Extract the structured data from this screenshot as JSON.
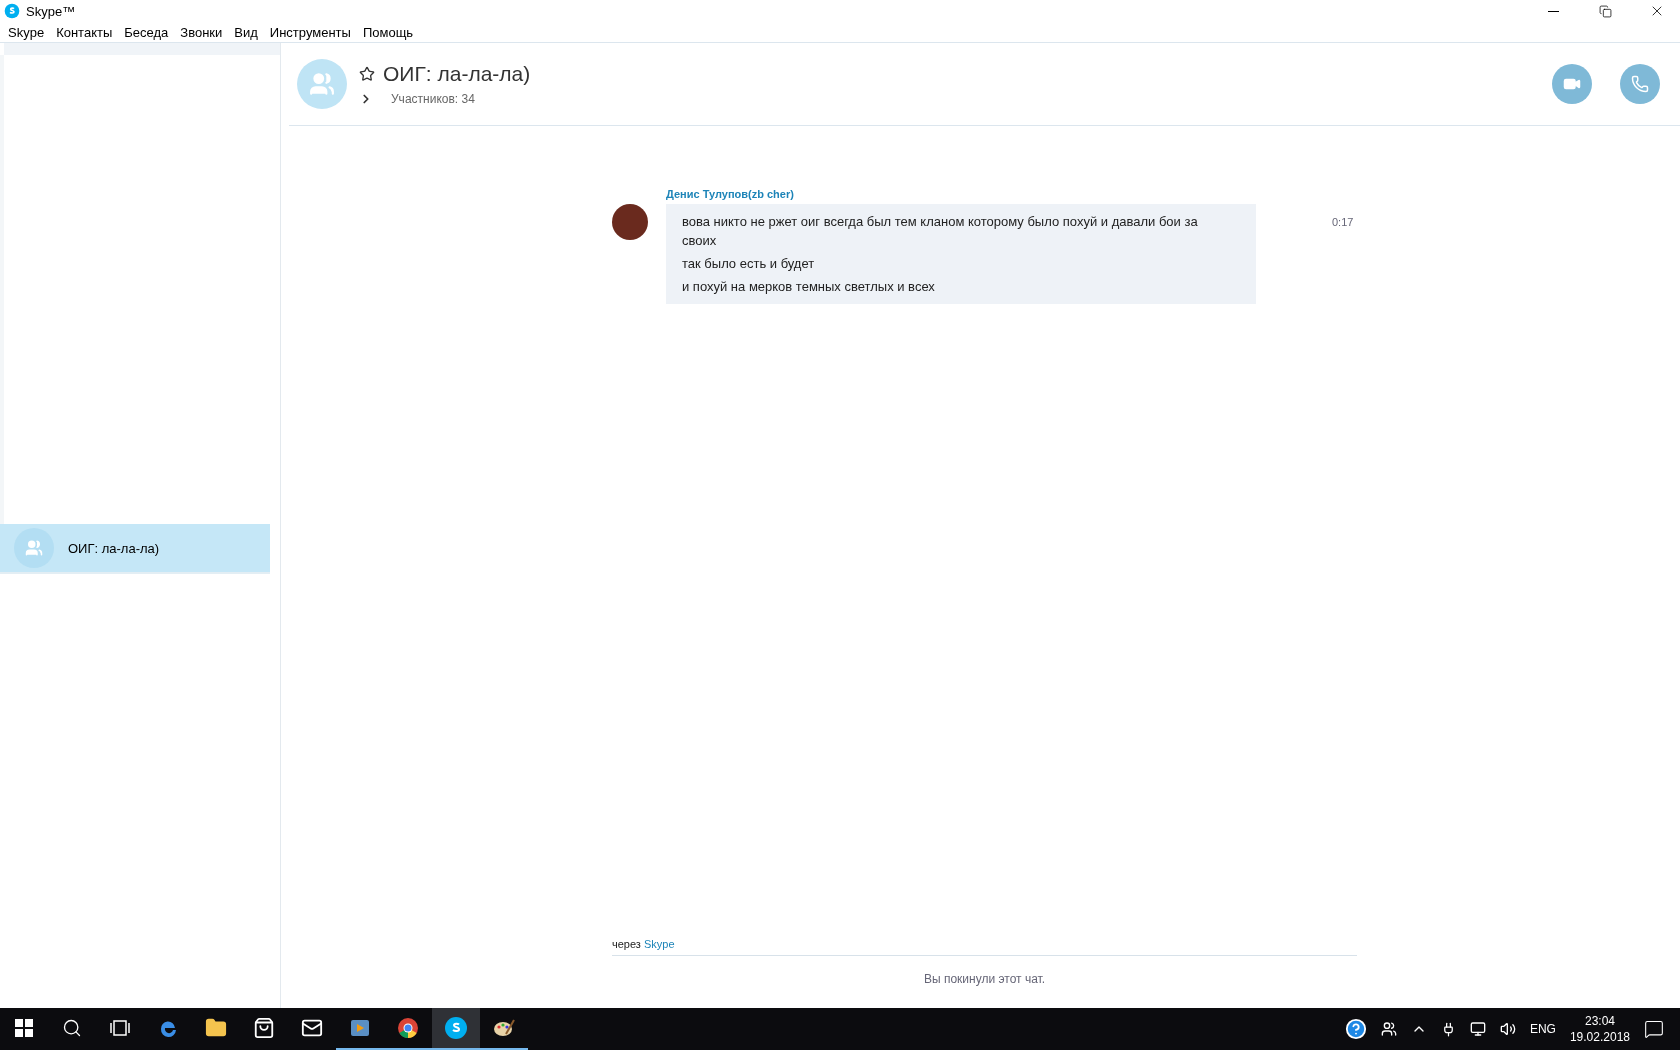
{
  "window": {
    "title": "Skype™"
  },
  "menu": [
    "Skype",
    "Контакты",
    "Беседа",
    "Звонки",
    "Вид",
    "Инструменты",
    "Помощь"
  ],
  "sidebar": {
    "items": [
      {
        "title": "ОИГ: ла-ла-ла)",
        "selected": true
      }
    ]
  },
  "conversation": {
    "title": "ОИГ: ла-ла-ла)",
    "favorite": false,
    "participants": "Участников: 34"
  },
  "messages": [
    {
      "author": "Денис Тулупов(zb cher)",
      "time": "0:17",
      "lines": [
        "вова никто не ржет оиг всегда был тем кланом которому было похуй и давали бои за своих",
        "так было есть и будет",
        "и похуй на мерков темных светлых и всех"
      ]
    }
  ],
  "footer": {
    "via": "через",
    "via_link": "Skype",
    "notice": "Вы покинули этот чат."
  },
  "taskbar": {
    "apps": [
      {
        "kind": "edge",
        "running": false,
        "selected": false
      },
      {
        "kind": "folder",
        "running": false,
        "selected": false
      },
      {
        "kind": "store",
        "running": false,
        "selected": false
      },
      {
        "kind": "mail",
        "running": false,
        "selected": false
      },
      {
        "kind": "player",
        "running": true,
        "selected": false
      },
      {
        "kind": "chrome",
        "running": true,
        "selected": false
      },
      {
        "kind": "skype",
        "running": true,
        "selected": true
      },
      {
        "kind": "paint",
        "running": true,
        "selected": false
      }
    ],
    "language": "ENG",
    "time": "23:04",
    "date": "19.02.2018"
  }
}
